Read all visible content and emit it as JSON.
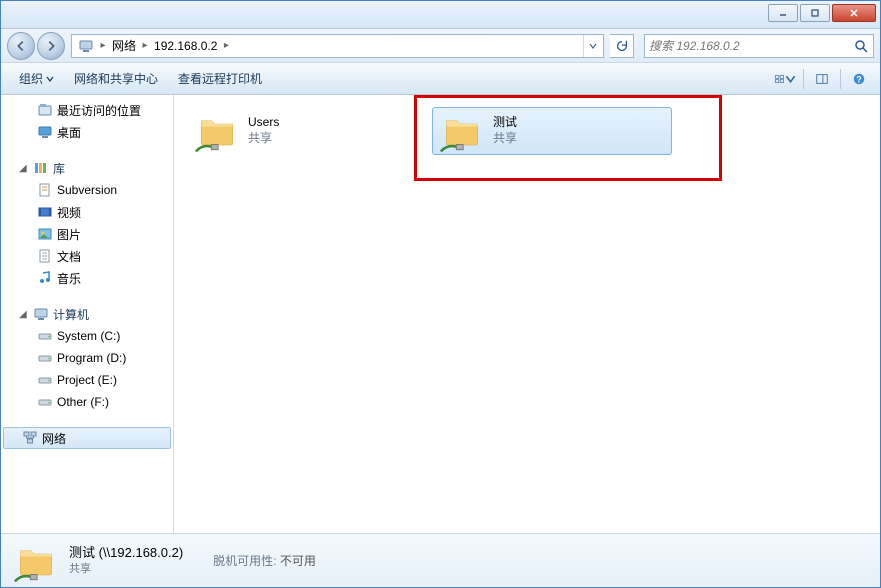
{
  "address": {
    "segments": [
      "网络",
      "192.168.0.2"
    ]
  },
  "search": {
    "placeholder": "搜索 192.168.0.2"
  },
  "toolbar": {
    "organize": "组织",
    "network_center": "网络和共享中心",
    "view_printers": "查看远程打印机"
  },
  "sidebar": {
    "recent": "最近访问的位置",
    "desktop": "桌面",
    "libraries": "库",
    "lib_items": [
      "Subversion",
      "视频",
      "图片",
      "文档",
      "音乐"
    ],
    "computer": "计算机",
    "drives": [
      "System (C:)",
      "Program (D:)",
      "Project (E:)",
      "Other (F:)"
    ],
    "network": "网络"
  },
  "content": {
    "items": [
      {
        "name": "Users",
        "sub": "共享",
        "selected": false
      },
      {
        "name": "测试",
        "sub": "共享",
        "selected": true
      }
    ]
  },
  "details": {
    "title": "测试 (\\\\192.168.0.2)",
    "sub": "共享",
    "offline_label": "脱机可用性:",
    "offline_value": "不可用"
  }
}
